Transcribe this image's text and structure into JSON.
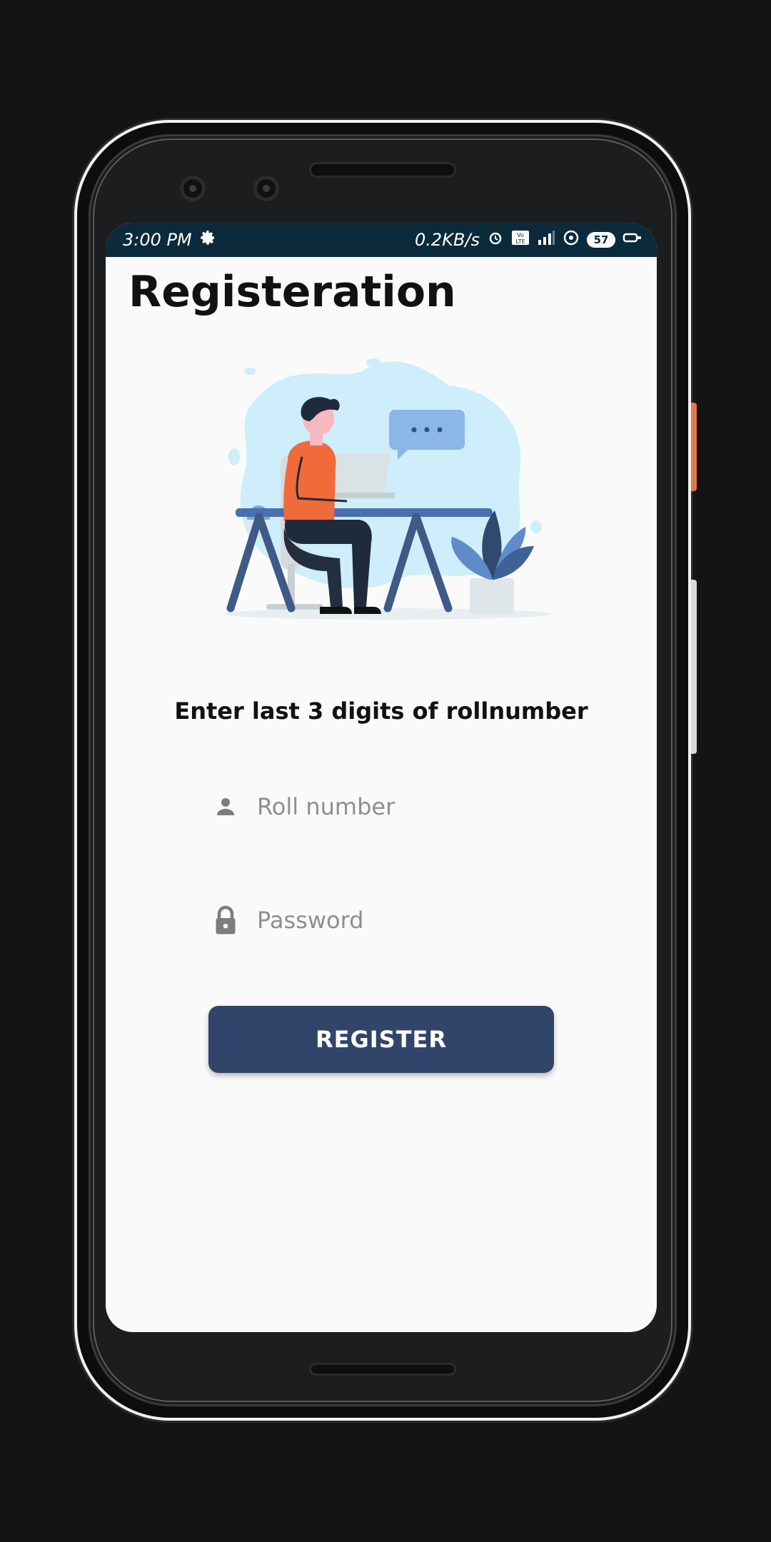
{
  "status_bar": {
    "time": "3:00 PM",
    "net_speed": "0.2KB/s",
    "lte_label": "Vo LTE",
    "battery_level": "57",
    "icons": [
      "gear-icon",
      "alarm-icon",
      "volte-icon",
      "signal-icon",
      "hotspot-icon",
      "battery-icon",
      "key-icon"
    ]
  },
  "page": {
    "title": "Registeration",
    "subtitle": "Enter last 3 digits of rollnumber"
  },
  "form": {
    "roll_placeholder": "Roll number",
    "password_placeholder": "Password",
    "register_label": "REGISTER"
  },
  "colors": {
    "status_bar": "#0b2a3b",
    "button": "#31456a",
    "background": "#fafafa",
    "placeholder": "#8f8f8f",
    "illustration_blob": "#cdeefa",
    "shirt": "#f06a3a"
  }
}
